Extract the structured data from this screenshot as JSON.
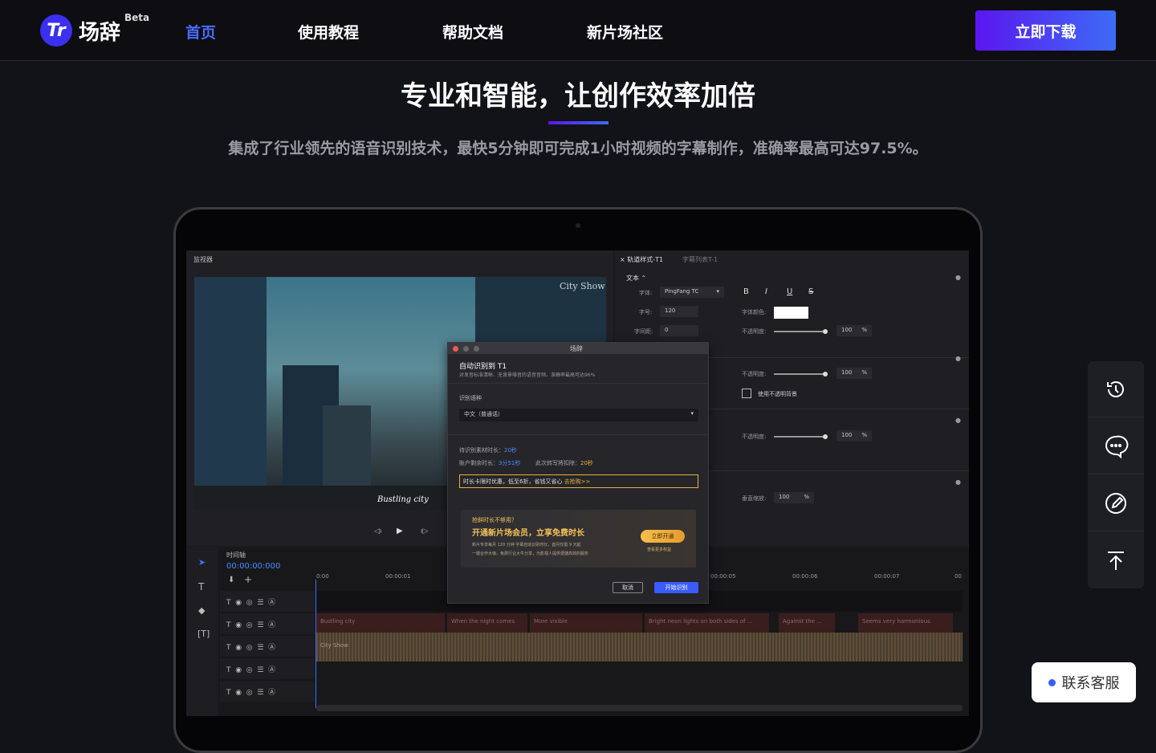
{
  "nav": {
    "logo_mark": "Tr",
    "brand": "场辞",
    "beta": "Beta",
    "links": [
      "首页",
      "使用教程",
      "帮助文档",
      "新片场社区"
    ],
    "download": "立即下载"
  },
  "hero": {
    "title": "专业和智能，让创作效率加倍",
    "subtitle": "集成了行业领先的语音识别技术，最快5分钟即可完成1小时视频的字幕制作，准确率最高可达97.5%。"
  },
  "app": {
    "monitor_label": "监视器",
    "video_text_1": "City Show",
    "video_text_2": "Bustling city",
    "style_tab": "轨道样式-T1",
    "list_tab": "字幕列表T-1",
    "text_section": "文本",
    "font_label": "字体:",
    "font_value": "PingFang TC",
    "size_label": "字号:",
    "size_value": "120",
    "spacing_label": "字间距:",
    "spacing_value": "0",
    "color_label": "字体颜色:",
    "opacity_label": "不透明度:",
    "opacity_value": "100",
    "percent": "%",
    "bg_opacity_check": "使用不透明背景",
    "vertical_label": "垂直缩放:",
    "format_buttons": [
      "B",
      "I",
      "U",
      "S"
    ],
    "timeline_label": "时间轴",
    "timecode": "00:00:00:000",
    "ruler": [
      "0:00",
      "00:00:01",
      "00:00:05",
      "00:00:06",
      "00:00:07",
      "00"
    ],
    "clips_row1": [
      "Bustling city",
      "When the night comes",
      "More visible",
      "Bright neon lights on both sides of ...",
      "Against the ...",
      "Seems very harmonious"
    ],
    "clip_row2": "City Show"
  },
  "dialog": {
    "window_title": "场辞",
    "heading": "自动识别到 T1",
    "desc": "对发音标准清晰、无背景噪音的语音音频，准确率最高可达96%",
    "lang_label": "识别语种",
    "lang_value": "中文（普通话）",
    "material_label": "待识别素材时长：",
    "material_value": "20秒",
    "remain_label": "账户剩余时长：",
    "remain_value": "3分51秒",
    "deduct_label": "此次转写将扣除：",
    "deduct_value": "20秒",
    "offer_text": "时长卡限时优惠，低至6折，省钱又省心",
    "offer_link": "去抢购>>",
    "promo_q": "抢鲜时长不够用？",
    "promo_title": "开通新片场会员，立享免费时长",
    "promo_desc_1": "新片专享每月 120 分钟 字幕自动识别时长，首月仅需 9 元起",
    "promo_desc_2": "一键合作大咖，免费行业大牛分享，为影视人提供便捷高效的服务",
    "promo_btn": "立即开通",
    "promo_more": "查看更多权益",
    "cancel": "取消",
    "start": "开始识别"
  },
  "side_icons": [
    "history-icon",
    "chat-icon",
    "edit-icon",
    "back-to-top-icon"
  ],
  "contact": "联系客服"
}
